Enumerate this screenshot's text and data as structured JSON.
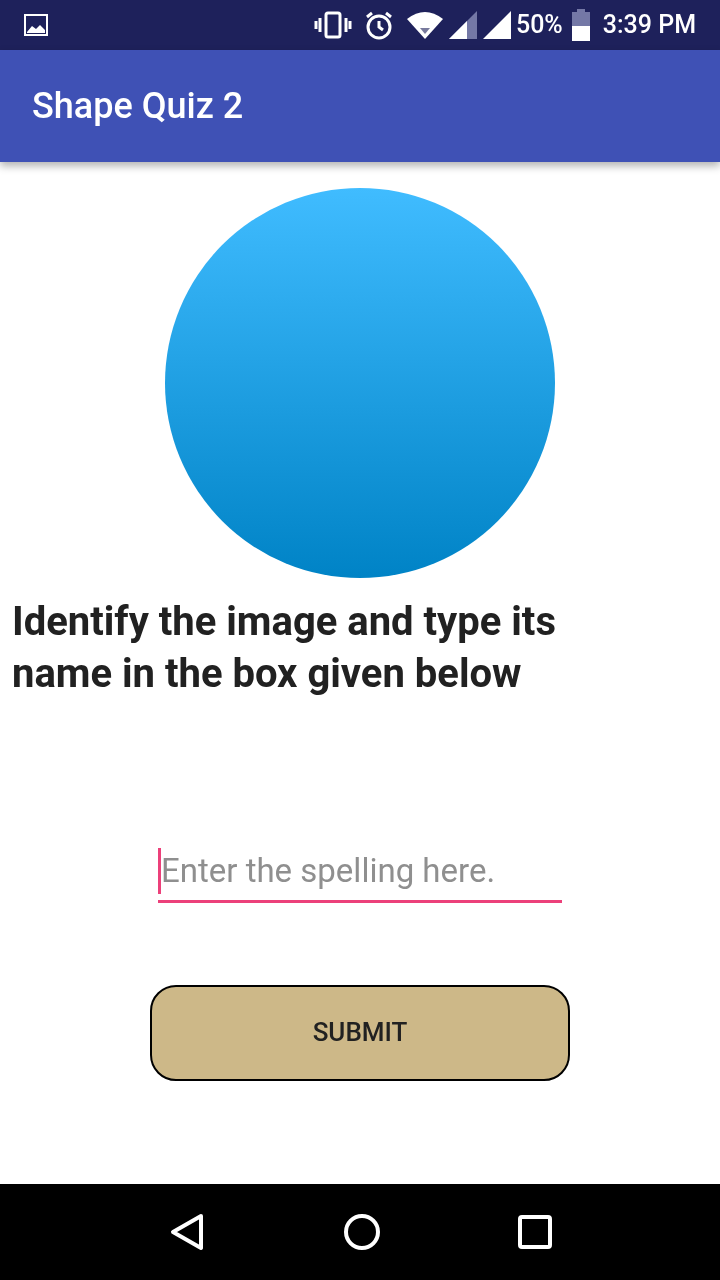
{
  "status_bar": {
    "battery": "50%",
    "time": "3:39 PM"
  },
  "app_bar": {
    "title": "Shape Quiz 2"
  },
  "question": "Identify the image and type its name in the box given below",
  "answer_field": {
    "placeholder": "Enter the spelling here.",
    "focused": true
  },
  "submit_button": "SUBMIT"
}
